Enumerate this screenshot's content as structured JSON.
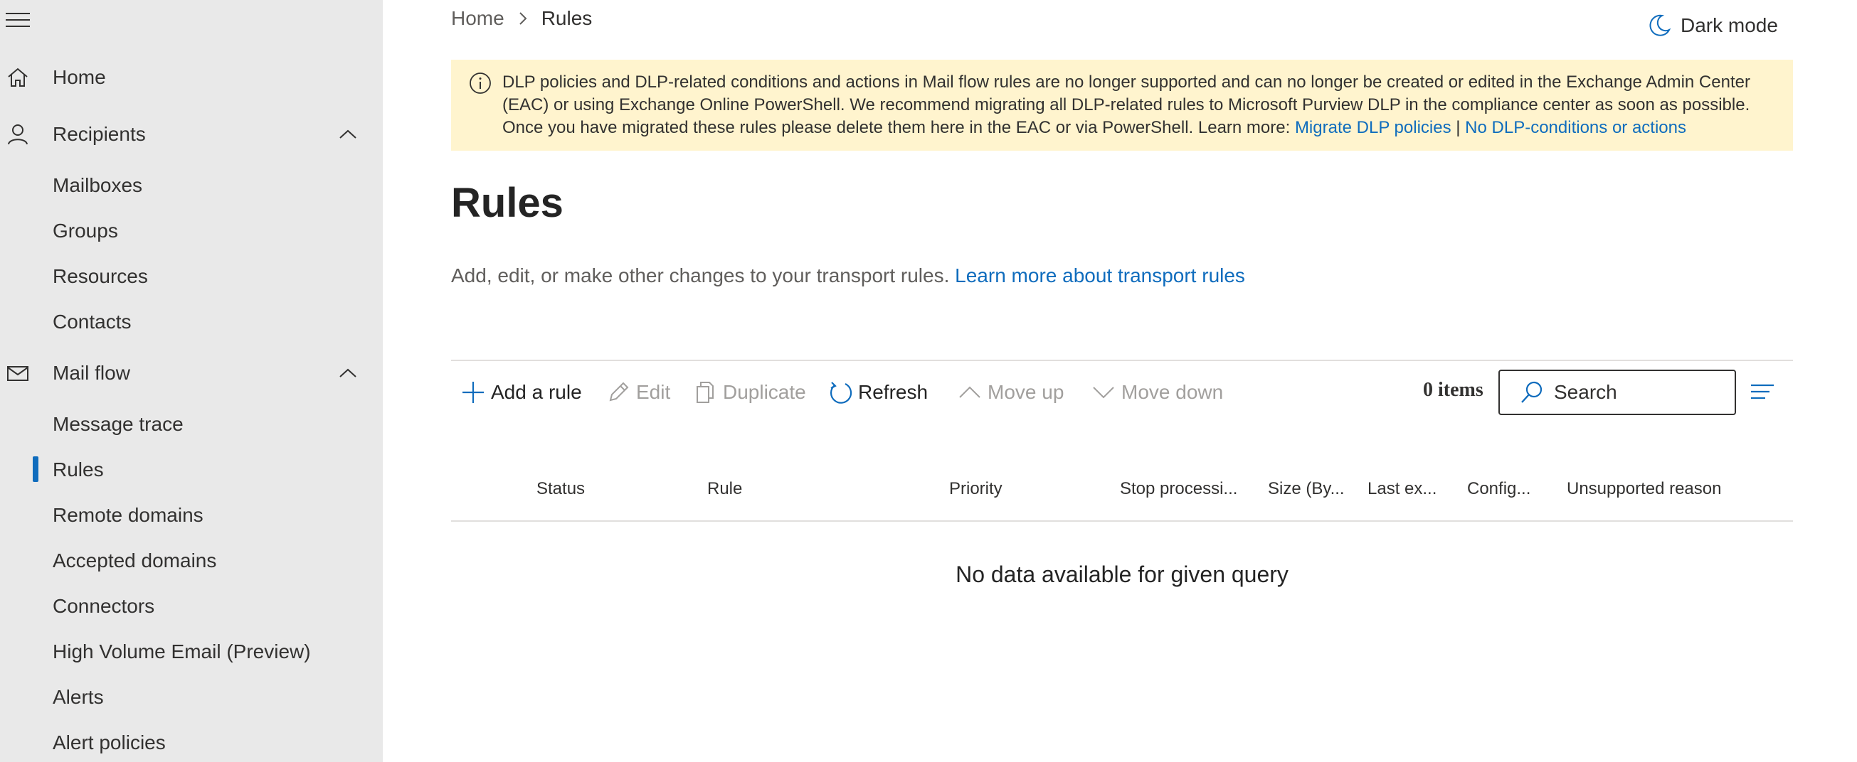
{
  "sidebar": {
    "items": [
      {
        "label": "Home"
      },
      {
        "label": "Recipients"
      },
      {
        "label": "Mailboxes"
      },
      {
        "label": "Groups"
      },
      {
        "label": "Resources"
      },
      {
        "label": "Contacts"
      },
      {
        "label": "Mail flow"
      },
      {
        "label": "Message trace"
      },
      {
        "label": "Rules"
      },
      {
        "label": "Remote domains"
      },
      {
        "label": "Accepted domains"
      },
      {
        "label": "Connectors"
      },
      {
        "label": "High Volume Email (Preview)"
      },
      {
        "label": "Alerts"
      },
      {
        "label": "Alert policies"
      }
    ],
    "active_item": "Rules"
  },
  "breadcrumb": {
    "home": "Home",
    "current": "Rules"
  },
  "header": {
    "dark_mode_label": "Dark mode"
  },
  "banner": {
    "text": "DLP policies and DLP-related conditions and actions in Mail flow rules are no longer supported and can no longer be created or edited in the Exchange Admin Center (EAC) or using Exchange Online PowerShell. We recommend migrating all DLP-related rules to Microsoft Purview DLP in the compliance center as soon as possible. Once you have migrated these rules please delete them here in the EAC or via PowerShell. Learn more: ",
    "link1": "Migrate DLP policies",
    "separator": " | ",
    "link2": "No DLP-conditions or actions"
  },
  "page": {
    "title": "Rules",
    "description": "Add, edit, or make other changes to your transport rules. ",
    "description_link": "Learn more about transport rules"
  },
  "toolbar": {
    "add": "Add a rule",
    "edit": "Edit",
    "duplicate": "Duplicate",
    "refresh": "Refresh",
    "move_up": "Move up",
    "move_down": "Move down",
    "item_count": "0 items",
    "search_placeholder": "Search"
  },
  "table": {
    "columns": [
      "Status",
      "Rule",
      "Priority",
      "Stop processi...",
      "Size (By...",
      "Last ex...",
      "Config...",
      "Unsupported reason"
    ],
    "empty_message": "No data available for given query"
  },
  "colors": {
    "accent": "#0f6cbd",
    "banner_bg": "#fff4ce",
    "sidebar_bg": "#e9e9e9",
    "disabled_text": "#a19f9d"
  }
}
